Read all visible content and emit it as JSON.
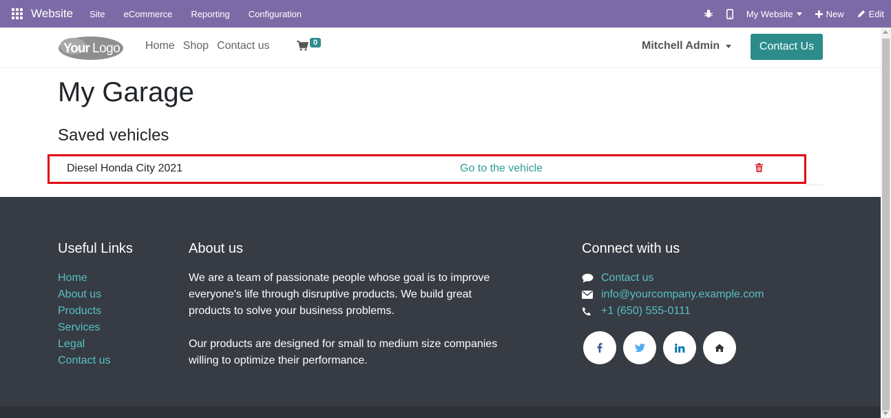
{
  "topbar": {
    "brand": "Website",
    "menu": [
      "Site",
      "eCommerce",
      "Reporting",
      "Configuration"
    ],
    "my_website": "My Website",
    "new_label": "New",
    "edit_label": "Edit"
  },
  "header": {
    "logo_text": "YourLogo",
    "nav": [
      "Home",
      "Shop",
      "Contact us"
    ],
    "cart_count": "0",
    "user_name": "Mitchell Admin",
    "contact_button": "Contact Us"
  },
  "main": {
    "title": "My Garage",
    "section_title": "Saved vehicles",
    "vehicles": [
      {
        "name": "Diesel Honda City 2021",
        "link": "Go to the vehicle"
      }
    ]
  },
  "footer": {
    "useful_links_title": "Useful Links",
    "useful_links": [
      "Home",
      "About us",
      "Products",
      "Services",
      "Legal",
      "Contact us"
    ],
    "about_title": "About us",
    "about_p1": "We are a team of passionate people whose goal is to improve everyone's life through disruptive products. We build great products to solve your business problems.",
    "about_p2": "Our products are designed for small to medium size companies willing to optimize their performance.",
    "connect_title": "Connect with us",
    "contact_link": "Contact us",
    "email": "info@yourcompany.example.com",
    "phone": "+1 (650) 555-0111",
    "socials": [
      "facebook-icon",
      "twitter-icon",
      "linkedin-icon",
      "home-icon"
    ]
  },
  "colors": {
    "topbar": "#7c6aa6",
    "accent": "#2c8c8c",
    "link": "#56c1c4",
    "highlight": "#e1000f",
    "footer": "#373b43"
  }
}
